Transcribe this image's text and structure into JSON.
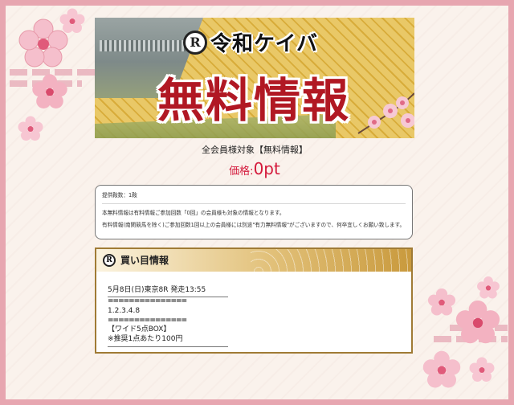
{
  "banner": {
    "logo_mark": "R",
    "logo_text": "令和ケイバ",
    "title": "無料情報"
  },
  "target_text": "全会員様対象【無料情報】",
  "price": {
    "label": "価格:",
    "value": "0pt"
  },
  "notice": {
    "count": "提供鞍数：1鞍",
    "line1": "本無料情報は有料情報ご参加回数「0回」の会員様も対象の情報となります。",
    "line2": "有料情報(南関競馬を除く)ご参加回数1回以上の会員様には別途\"有力無料情報\"がございますので、何卒宜しくお願い致します。"
  },
  "buy_info": {
    "header": "買い目情報",
    "race": "5月8日(日)東京8R 発走13:55",
    "separator": "===============",
    "horses": "1.2.3.4.8",
    "bet_type": "【ワイド5点BOX】",
    "recommend": "※推奨1点あたり100円"
  },
  "colors": {
    "frame": "#e7a6b0",
    "price": "#d41a3c",
    "title_red": "#b11823",
    "gold": "#a07b35"
  }
}
